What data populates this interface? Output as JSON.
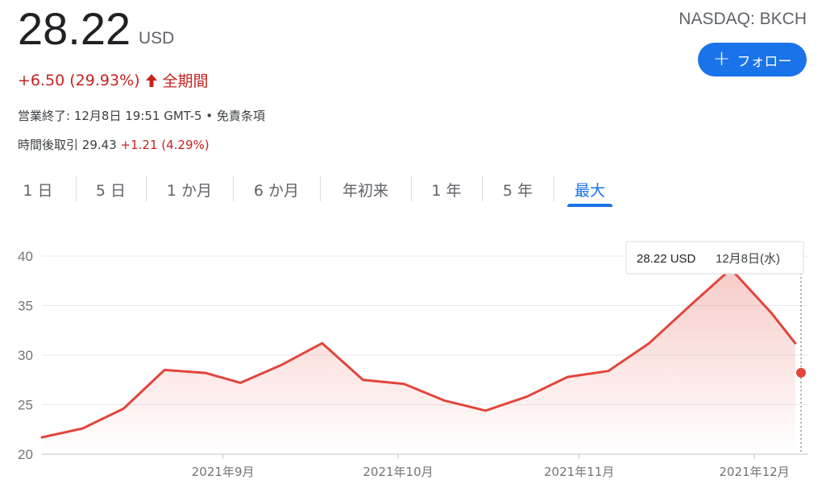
{
  "quote": {
    "price": "28.22",
    "currency": "USD",
    "exchange_ticker": "NASDAQ: BKCH",
    "change": "+6.50 (29.93%)",
    "period": "全期間",
    "market_status": "営業終了: 12月8日 19:51 GMT-5 • 免責条項",
    "after_hours_label": "時間後取引",
    "after_hours_price": "29.43",
    "after_hours_change": "+1.21 (4.29%)"
  },
  "follow_button": {
    "label": "フォロー",
    "icon": "plus-icon"
  },
  "tabs": [
    {
      "label": "1 日",
      "active": false
    },
    {
      "label": "5 日",
      "active": false
    },
    {
      "label": "1 か月",
      "active": false
    },
    {
      "label": "6 か月",
      "active": false
    },
    {
      "label": "年初来",
      "active": false
    },
    {
      "label": "1 年",
      "active": false
    },
    {
      "label": "5 年",
      "active": false
    },
    {
      "label": "最大",
      "active": true
    }
  ],
  "colors": {
    "line": "#e0463c",
    "positive": "#c5221f",
    "accent": "#1a73e8",
    "grid": "#e8eaed",
    "axis_text": "#70757a"
  },
  "chart_data": {
    "type": "area",
    "ylim": [
      20,
      40
    ],
    "yticks": [
      20,
      25,
      30,
      35,
      40
    ],
    "xlim": [
      "2021-08-01",
      "2021-12-09"
    ],
    "x_ticks": [
      {
        "date": "2021-09-01",
        "label": "2021年9月"
      },
      {
        "date": "2021-10-01",
        "label": "2021年10月"
      },
      {
        "date": "2021-11-01",
        "label": "2021年11月"
      },
      {
        "date": "2021-12-01",
        "label": "2021年12月"
      }
    ],
    "grid": true,
    "series": [
      {
        "x": [
          "2021-08-01",
          "2021-08-08",
          "2021-08-15",
          "2021-08-22",
          "2021-08-29",
          "2021-09-04",
          "2021-09-11",
          "2021-09-18",
          "2021-09-25",
          "2021-10-02",
          "2021-10-09",
          "2021-10-16",
          "2021-10-23",
          "2021-10-30",
          "2021-11-06",
          "2021-11-13",
          "2021-11-20",
          "2021-11-27",
          "2021-12-04",
          "2021-12-08"
        ],
        "y": [
          21.7,
          22.6,
          24.6,
          28.5,
          28.2,
          27.2,
          29.0,
          31.2,
          27.5,
          27.1,
          25.4,
          24.4,
          25.8,
          27.8,
          28.4,
          31.2,
          35.0,
          38.7,
          34.2,
          31.2
        ]
      }
    ],
    "tooltip": {
      "value": "28.22 USD",
      "date": "12月8日(水)"
    }
  }
}
